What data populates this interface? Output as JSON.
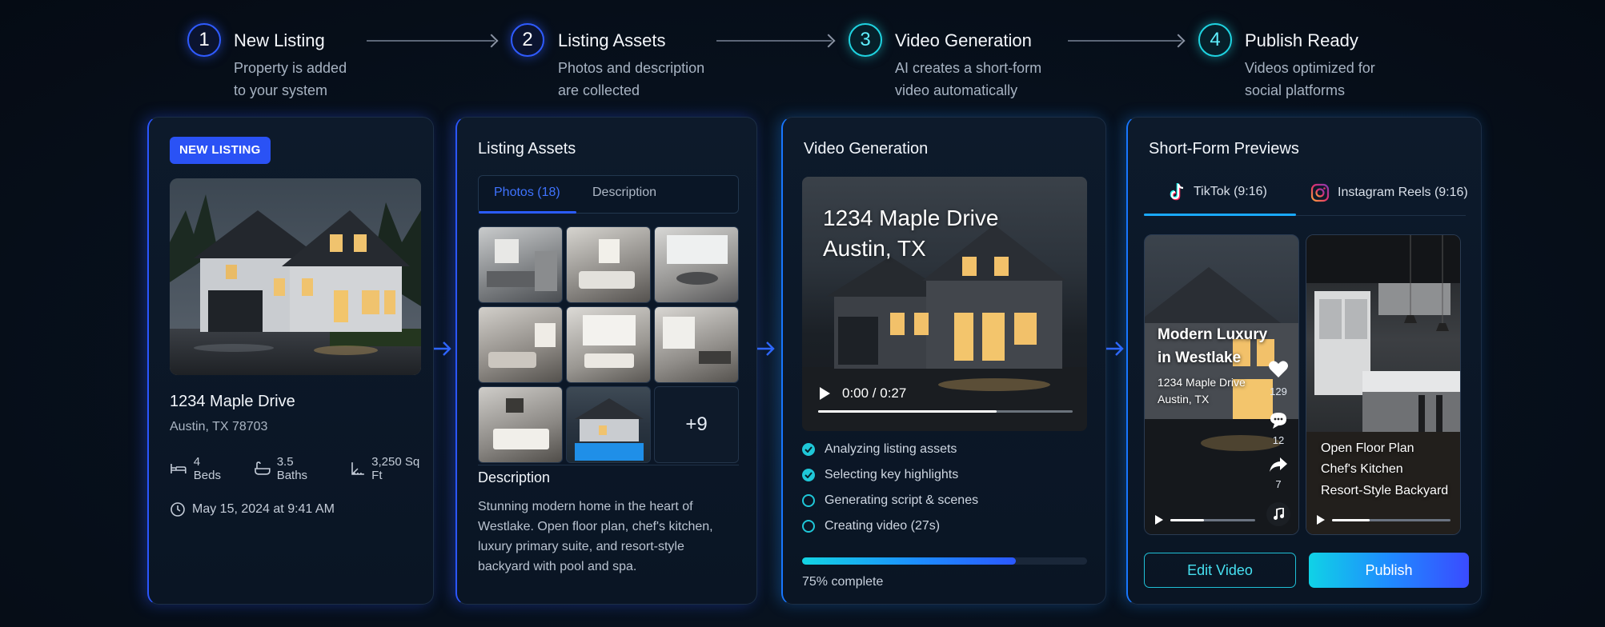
{
  "steps": [
    {
      "number": "1",
      "title": "New Listing",
      "desc": "Property is added\nto your system"
    },
    {
      "number": "2",
      "title": "Listing Assets",
      "desc": "Photos and description\nare collected"
    },
    {
      "number": "3",
      "title": "Video Generation",
      "desc": "AI creates a short-form\nvideo automatically"
    },
    {
      "number": "4",
      "title": "Publish Ready",
      "desc": "Videos optimized for\nsocial platforms"
    }
  ],
  "listing": {
    "badge": "NEW LISTING",
    "address": "1234 Maple Drive",
    "city": "Austin, TX 78703",
    "beds": "4 Beds",
    "baths": "3.5 Baths",
    "sqft": "3,250 Sq Ft",
    "date": "May 15, 2024 at 9:41 AM"
  },
  "assets": {
    "title": "Listing Assets",
    "tab_photos": "Photos (18)",
    "tab_description": "Description",
    "more_count": "+9",
    "desc_title": "Description",
    "desc_text": "Stunning modern home in the heart of Westlake. Open floor plan, chef's kitchen, luxury primary suite, and resort-style backyard with pool and spa."
  },
  "video": {
    "title": "Video Generation",
    "overlay_line1": "1234 Maple Drive",
    "overlay_line2": "Austin, TX",
    "time": "0:00 / 0:27",
    "scrub_fraction": 0.7,
    "steps": [
      {
        "label": "Analyzing listing assets",
        "done": true
      },
      {
        "label": "Selecting key highlights",
        "done": true
      },
      {
        "label": "Generating script & scenes",
        "done": false
      },
      {
        "label": "Creating video (27s)",
        "done": false
      }
    ],
    "progress_percent": 75,
    "progress_label": "75% complete"
  },
  "previews": {
    "title": "Short-Form Previews",
    "tab_tiktok": "TikTok (9:16)",
    "tab_reels": "Instagram Reels (9:16)",
    "tiktok_title_1": "Modern Luxury",
    "tiktok_title_2": "in Westlake",
    "tiktok_sub_1": "1234 Maple Drive",
    "tiktok_sub_2": "Austin, TX",
    "likes": "129",
    "comments": "12",
    "shares": "7",
    "reels_line1": "Open Floor Plan",
    "reels_line2": "Chef's Kitchen",
    "reels_line3": "Resort-Style Backyard",
    "edit_label": "Edit Video",
    "publish_label": "Publish"
  },
  "colors": {
    "accent_blue": "#2b56ff",
    "accent_cyan": "#1fd3e0",
    "background": "#07101c"
  }
}
